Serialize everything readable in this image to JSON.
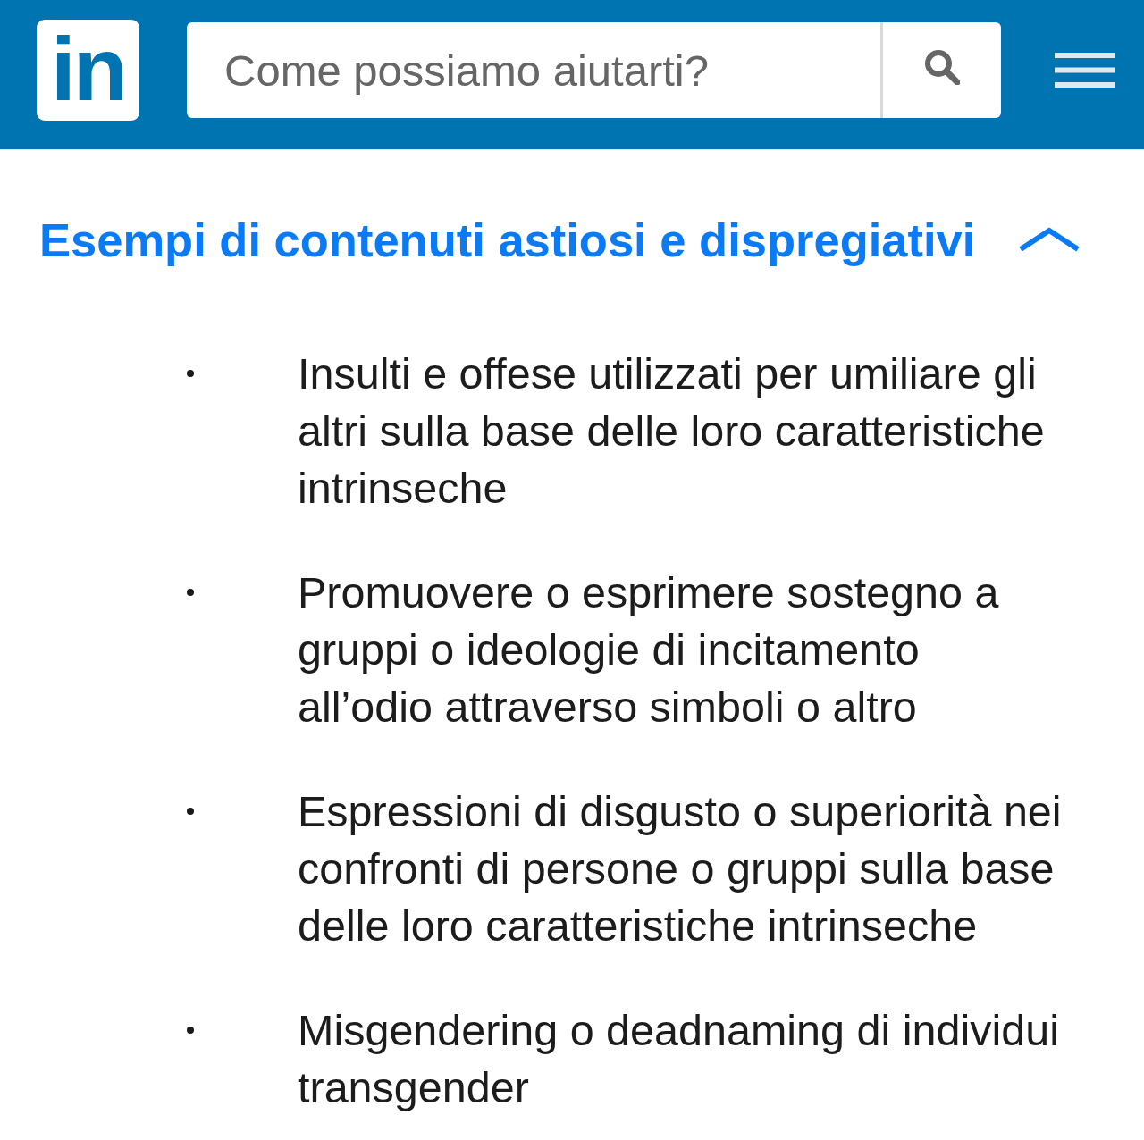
{
  "header": {
    "logo": "in",
    "search": {
      "placeholder": "Come possiamo aiutarti?"
    }
  },
  "section": {
    "title": "Esempi di contenuti astiosi e dispregiativi",
    "expanded": true,
    "items": [
      "Insulti e offese utilizzati per umiliare gli altri sulla base delle loro caratteristiche intrinseche",
      "Promuovere o esprimere sostegno a gruppi o ideologie di incitamento all’odio attraverso simboli o altro",
      "Espressioni di disgusto o superiorità nei confronti di persone o gruppi sulla base delle loro caratteristiche intrinseche",
      "Misgendering o deadnaming di individui transgender"
    ]
  }
}
